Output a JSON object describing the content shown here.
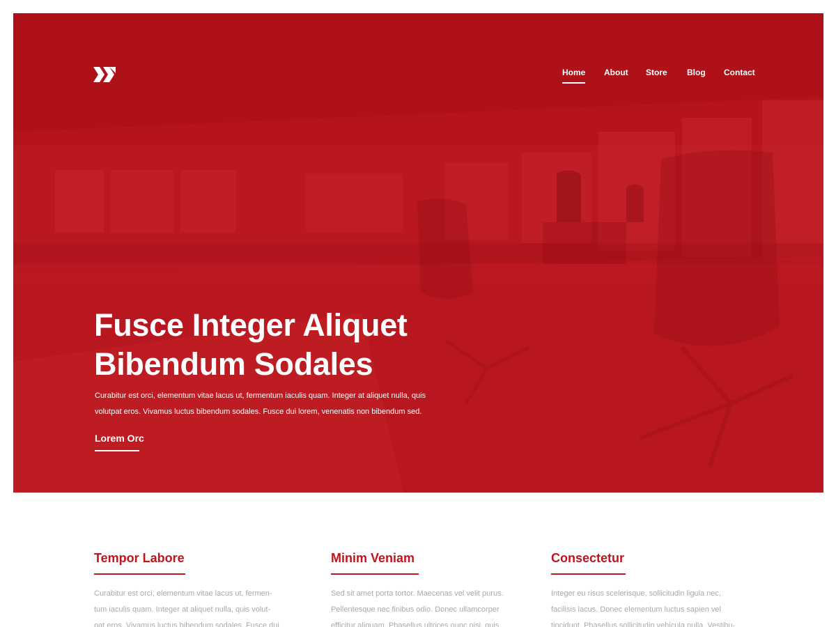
{
  "logo": {
    "icon": "double-chevron-logo"
  },
  "nav": {
    "items": [
      {
        "label": "Home",
        "active": true
      },
      {
        "label": "About",
        "active": false
      },
      {
        "label": "Store",
        "active": false
      },
      {
        "label": "Blog",
        "active": false
      },
      {
        "label": "Contact",
        "active": false
      }
    ]
  },
  "hero": {
    "title_line1": "Fusce Integer Aliquet",
    "title_line2": "Bibendum Sodales",
    "text_line1": "Curabitur est orci, elementum vitae lacus ut, fermentum iaculis quam. Integer at aliquet nulla, quis",
    "text_line2": "volutpat eros. Vivamus luctus bibendum sodales. Fusce dui lorem, venenatis non bibendum sed.",
    "cta": "Lorem Orc"
  },
  "features": [
    {
      "title": "Tempor Labore",
      "lines": [
        "Curabitur est orci, elementum vitae lacus ut, fermen-",
        "tum iaculis quam. Integer at aliquet nulla, quis volut-",
        "pat eros. Vivamus luctus bibendum sodales. Fusce dui"
      ]
    },
    {
      "title": "Minim Veniam",
      "lines": [
        "Sed sit amet porta tortor. Maecenas vel velit purus.",
        "Pellentesque nec finibus odio. Donec ullamcorper",
        "efficitur aliquam. Phasellus ultrices nunc nisi, quis"
      ]
    },
    {
      "title": "Consectetur",
      "lines": [
        "Integer eu risus scelerisque, sollicitudin ligula nec,",
        "facilisis lacus. Donec elementum luctus sapien vel",
        "tincidunt. Phasellus sollicitudin vehicula nulla. Vestibu-"
      ]
    }
  ],
  "colors": {
    "hero_red": "#b7141c",
    "accent_red": "#c0141d",
    "body_text": "#a9a9a9"
  }
}
